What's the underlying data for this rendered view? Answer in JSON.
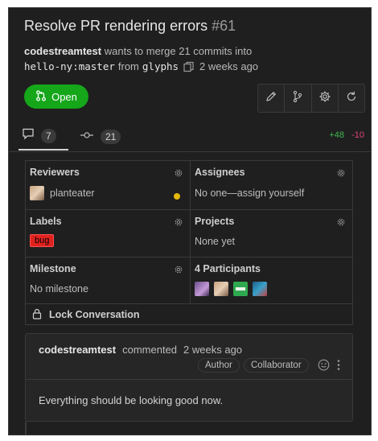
{
  "title": {
    "text": "Resolve PR rendering errors",
    "number": "#61"
  },
  "merge_info": {
    "author": "codestreamtest",
    "action": "wants to merge 21 commits into",
    "target": "hello-ny:master",
    "from_word": "from",
    "source": "glyphs",
    "time": "2 weeks ago"
  },
  "state_button": {
    "label": "Open",
    "color": "#15a61a"
  },
  "toolbar": {
    "icons": [
      "pencil-icon",
      "branch-icon",
      "gear-icon",
      "refresh-icon"
    ]
  },
  "tabs": [
    {
      "icon": "comment-icon",
      "count": "7"
    },
    {
      "icon": "commit-icon",
      "count": "21"
    }
  ],
  "diff": {
    "added": "+48",
    "removed": "-10"
  },
  "sidebar": {
    "reviewers": {
      "heading": "Reviewers",
      "user": "planteater"
    },
    "assignees": {
      "heading": "Assignees",
      "value": "No one—assign yourself"
    },
    "labels": {
      "heading": "Labels",
      "label": "bug"
    },
    "projects": {
      "heading": "Projects",
      "value": "None yet"
    },
    "milestone": {
      "heading": "Milestone",
      "value": "No milestone"
    },
    "participants": {
      "heading": "4 Participants"
    },
    "lock": {
      "label": "Lock Conversation"
    }
  },
  "comment": {
    "author": "codestreamtest",
    "action": "commented",
    "time": "2 weeks ago",
    "badges": [
      "Author",
      "Collaborator"
    ],
    "body": "Everything should be looking good now."
  }
}
